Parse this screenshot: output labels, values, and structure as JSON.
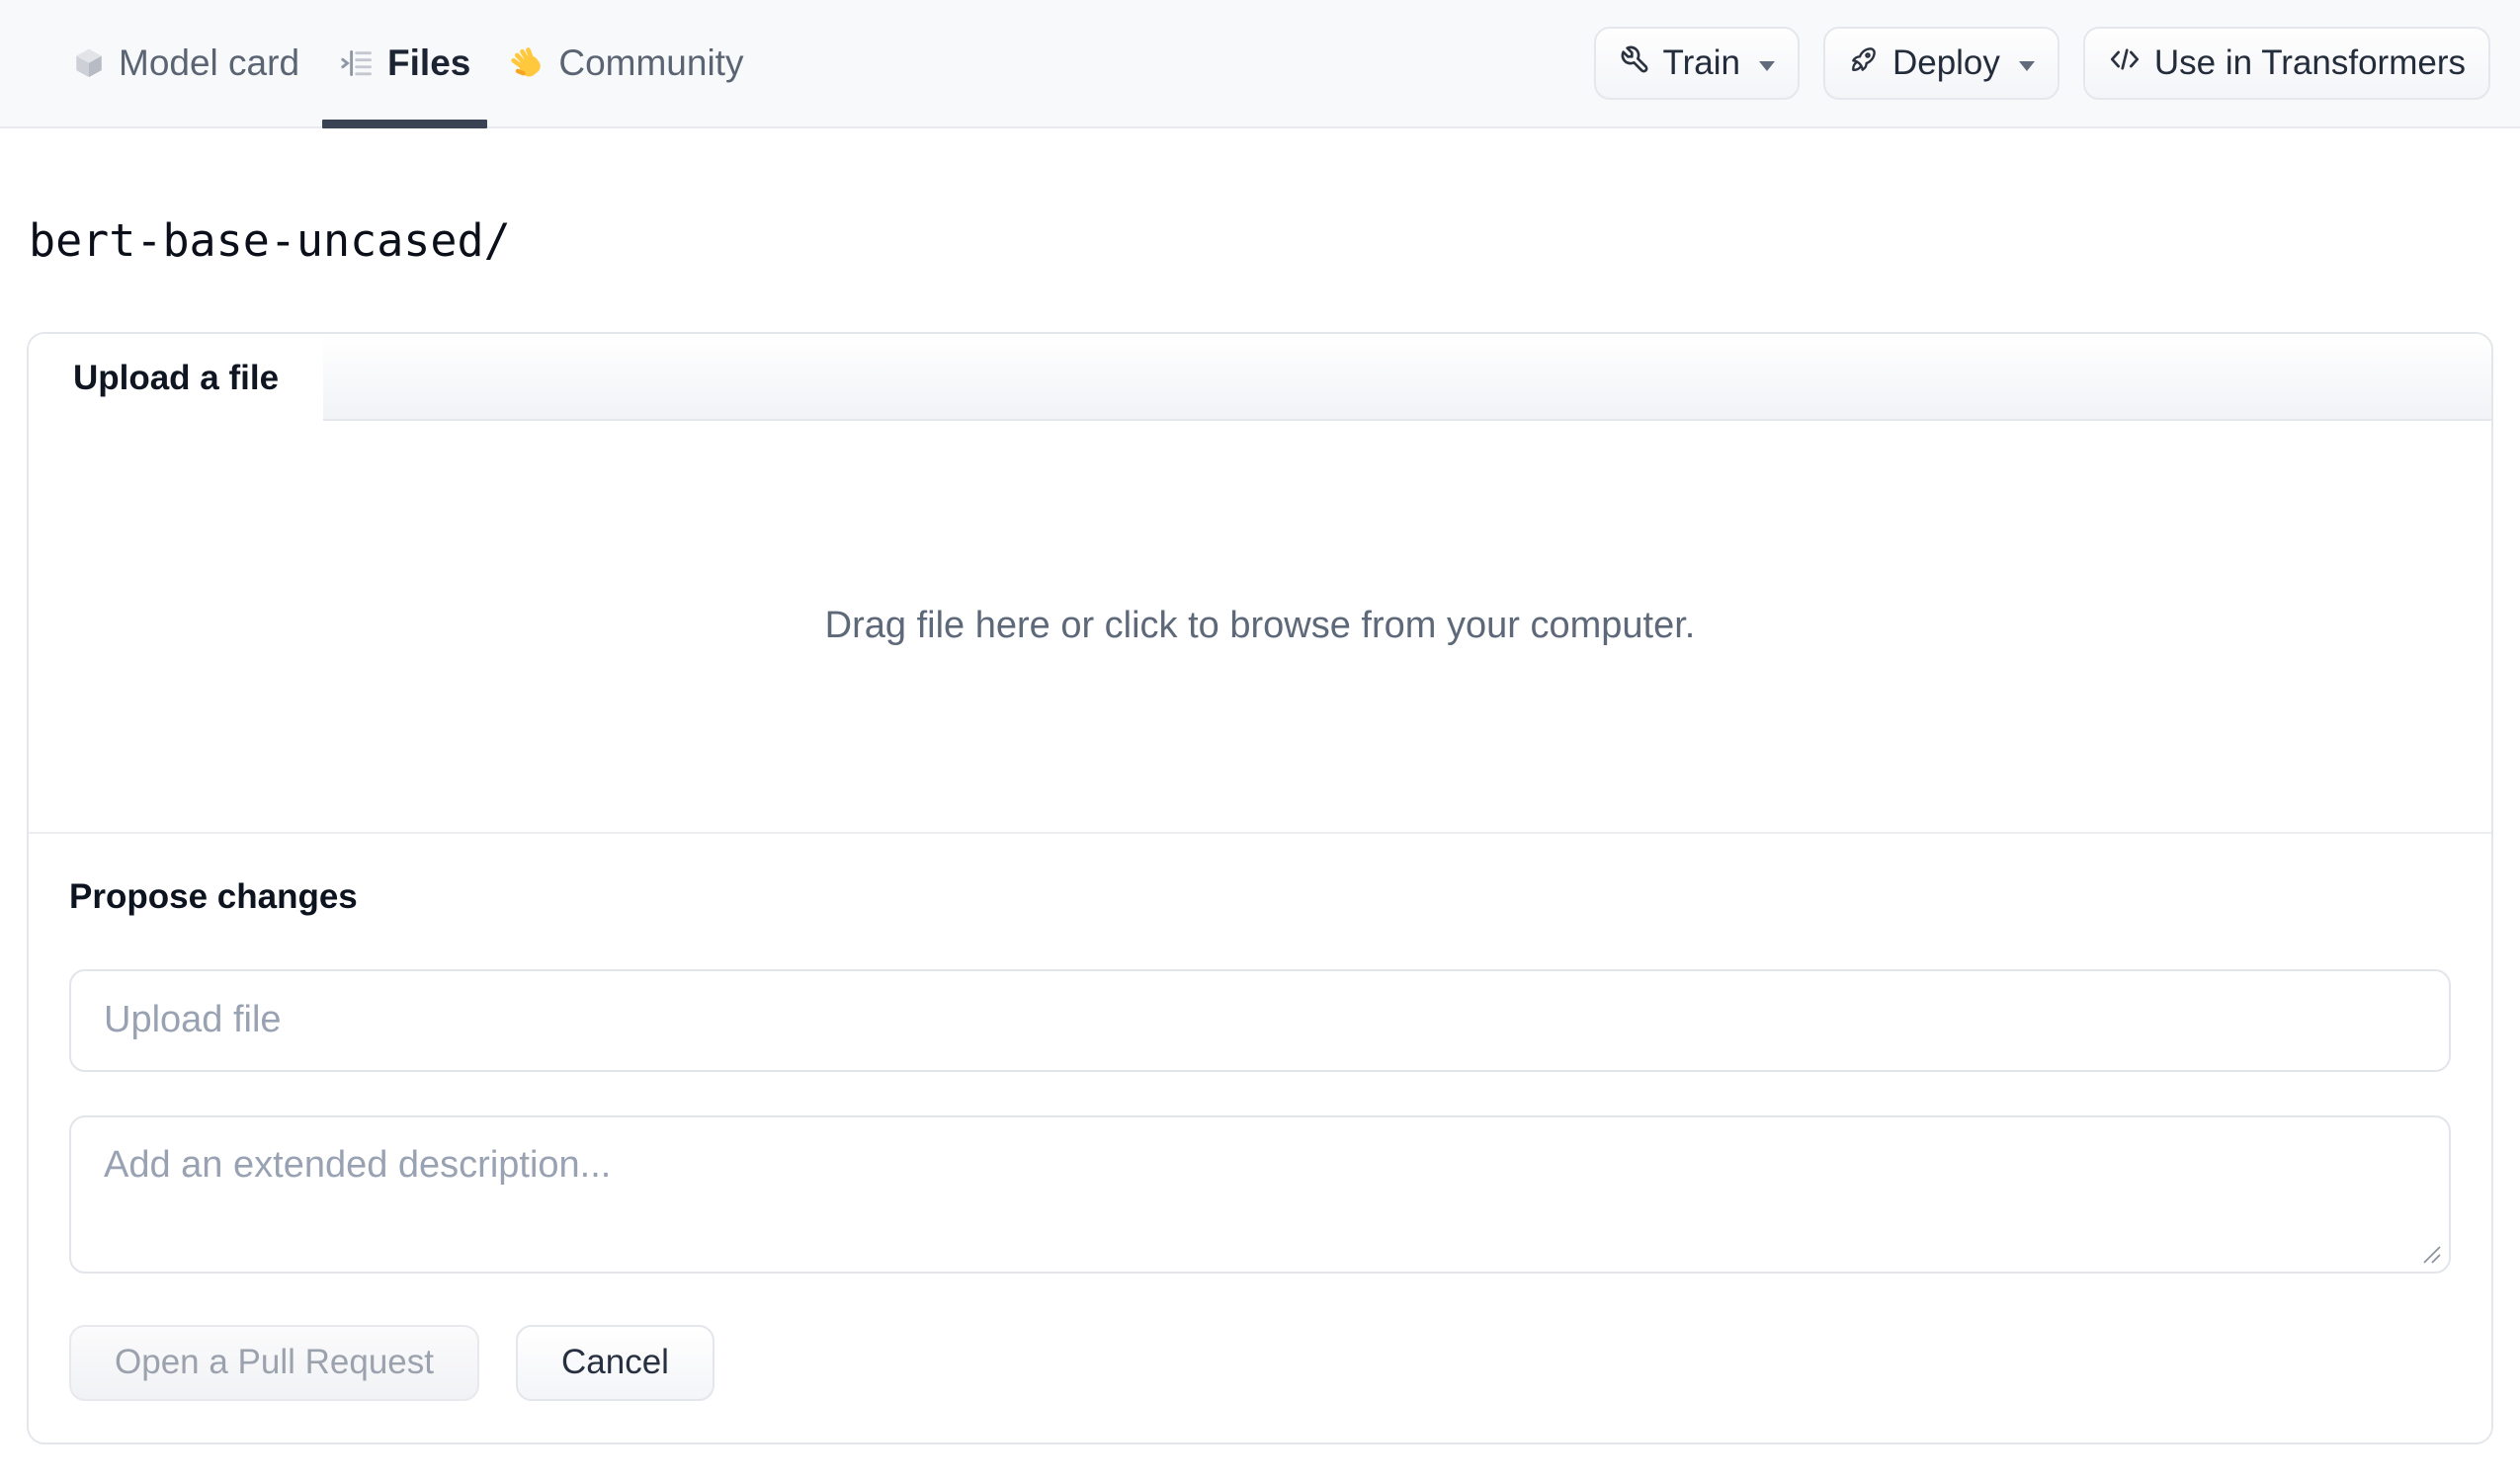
{
  "header": {
    "tabs": [
      {
        "label": "Model card",
        "icon": "cube-icon",
        "active": false
      },
      {
        "label": "Files",
        "icon": "files-list-icon",
        "active": true
      },
      {
        "label": "Community",
        "icon": "waving-hand-icon",
        "active": false
      }
    ],
    "actions": [
      {
        "label": "Train",
        "icon": "wrench-icon",
        "has_dropdown": true
      },
      {
        "label": "Deploy",
        "icon": "rocket-icon",
        "has_dropdown": true
      },
      {
        "label": "Use in Transformers",
        "icon": "code-icon",
        "has_dropdown": false
      }
    ]
  },
  "breadcrumb": {
    "path": "bert-base-uncased/"
  },
  "upload_panel": {
    "tab_label": "Upload a file",
    "dropzone_text": "Drag file here or click to browse from your computer.",
    "footer": {
      "heading": "Propose changes",
      "filename_placeholder": "Upload file",
      "description_placeholder": "Add an extended description...",
      "open_pr_label": "Open a Pull Request",
      "cancel_label": "Cancel"
    }
  },
  "colors": {
    "header_bg": "#f8f9fb",
    "active_tab_underline": "#3a4353",
    "panel_border": "#e3e6ea",
    "muted_text": "#5d6879",
    "placeholder_text": "#99a2b2",
    "disabled_button_text": "#9ba2ae",
    "hand_icon_yellow": "#ffc83d"
  }
}
